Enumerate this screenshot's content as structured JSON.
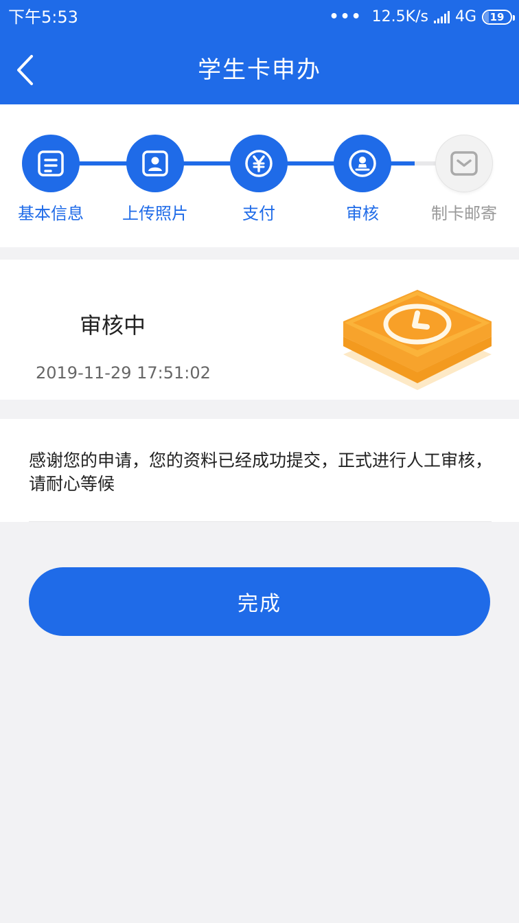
{
  "status_bar": {
    "time": "下午5:53",
    "dots": "•••",
    "net_speed": "12.5K/s",
    "network": "4G",
    "battery": "19"
  },
  "nav": {
    "title": "学生卡申办"
  },
  "steps": [
    {
      "label": "基本信息",
      "icon": "form-icon",
      "active": true
    },
    {
      "label": "上传照片",
      "icon": "id-photo-icon",
      "active": true
    },
    {
      "label": "支付",
      "icon": "yen-icon",
      "active": true
    },
    {
      "label": "审核",
      "icon": "review-stamp-icon",
      "active": true
    },
    {
      "label": "制卡邮寄",
      "icon": "envelope-icon",
      "active": false
    }
  ],
  "status": {
    "title": "审核中",
    "timestamp": "2019-11-29 17:51:02",
    "illustration": "clock-illustration"
  },
  "message": {
    "text": "感谢您的申请，您的资料已经成功提交，正式进行人工审核，请耐心等候"
  },
  "actions": {
    "done_label": "完成"
  },
  "colors": {
    "primary": "#1f6be8",
    "page_bg": "#f2f2f4",
    "inactive_text": "#999999",
    "illustration_orange": "#f7961c"
  }
}
